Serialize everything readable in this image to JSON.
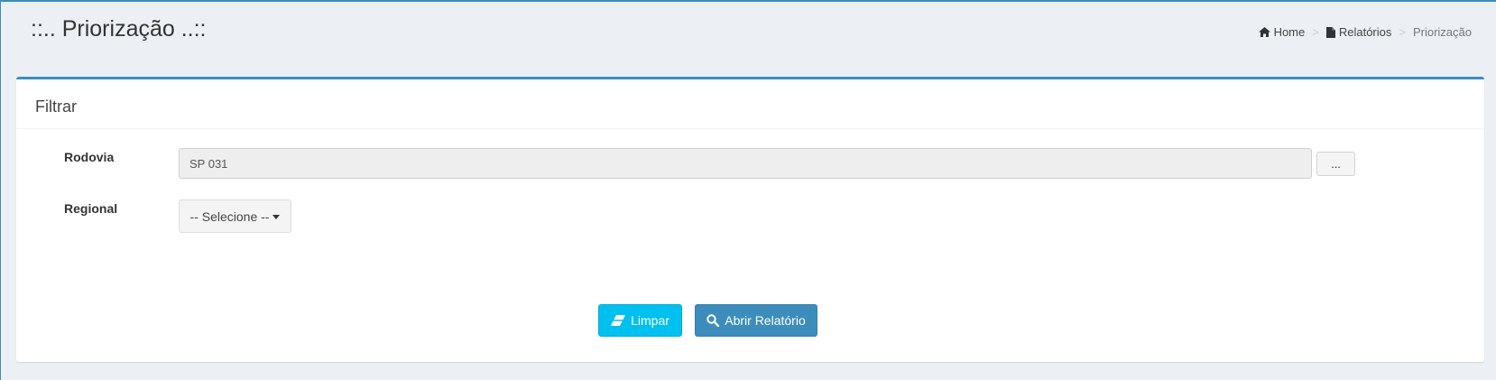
{
  "header": {
    "title": "::.. Priorização ..::"
  },
  "breadcrumb": {
    "items": [
      {
        "label": "Home",
        "icon": "home-icon"
      },
      {
        "label": "Relatórios",
        "icon": "file-icon"
      },
      {
        "label": "Priorização"
      }
    ],
    "separator": ">"
  },
  "filter": {
    "title": "Filtrar",
    "rodovia": {
      "label": "Rodovia",
      "value": "SP 031",
      "lookup_button": "..."
    },
    "regional": {
      "label": "Regional",
      "selected": "-- Selecione --"
    }
  },
  "actions": {
    "clear": {
      "label": "Limpar",
      "icon": "eraser-icon"
    },
    "open_report": {
      "label": "Abrir Relatório",
      "icon": "search-icon"
    }
  },
  "colors": {
    "primary": "#3c8dbc",
    "info": "#00c0ef",
    "background": "#ecf0f5"
  }
}
